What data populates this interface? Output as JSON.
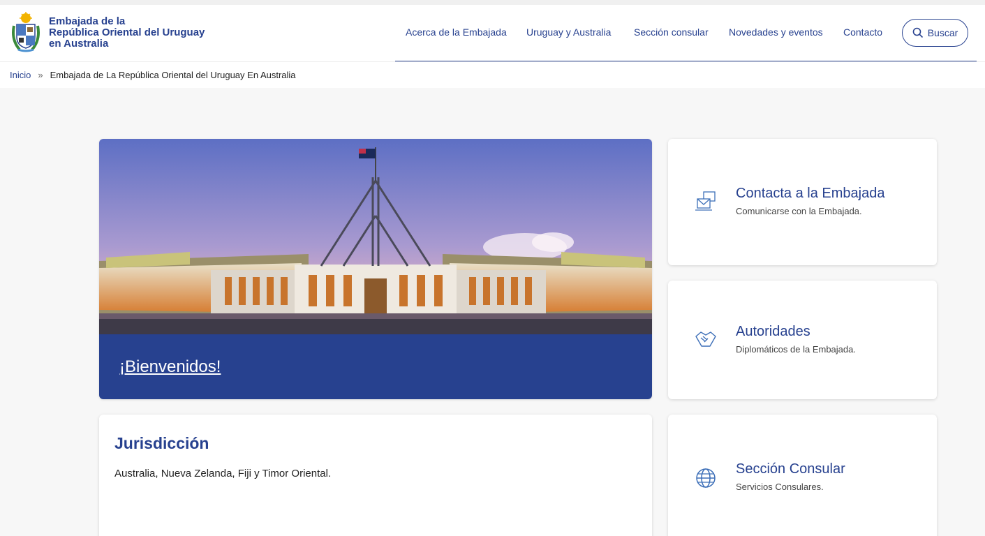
{
  "header": {
    "logo_lines": [
      "Embajada de la",
      "República Oriental del Uruguay",
      "en Australia"
    ],
    "nav": [
      {
        "label": "Acerca de la Embajada"
      },
      {
        "label": "Uruguay y Australia"
      },
      {
        "label": "Sección consular"
      },
      {
        "label": "Novedades y eventos"
      },
      {
        "label": "Contacto"
      }
    ],
    "search_label": "Buscar"
  },
  "breadcrumb": {
    "home": "Inicio",
    "separator": "»",
    "current": "Embajada de La República Oriental del Uruguay En Australia"
  },
  "hero": {
    "title": "¡Bienvenidos!"
  },
  "cards": [
    {
      "title": "Contacta a la Embajada",
      "subtitle": "Comunicarse con la Embajada.",
      "icon": "mail-contact-icon"
    },
    {
      "title": "Autoridades",
      "subtitle": "Diplomáticos de la Embajada.",
      "icon": "handshake-icon"
    },
    {
      "title": "Sección Consular",
      "subtitle": "Servicios Consulares.",
      "icon": "globe-icon"
    }
  ],
  "jurisdiction": {
    "title": "Jurisdicción",
    "text": "Australia, Nueva Zelanda, Fiji y Timor Oriental."
  },
  "colors": {
    "brand": "#27418f",
    "page_bg": "#f7f7f7"
  }
}
